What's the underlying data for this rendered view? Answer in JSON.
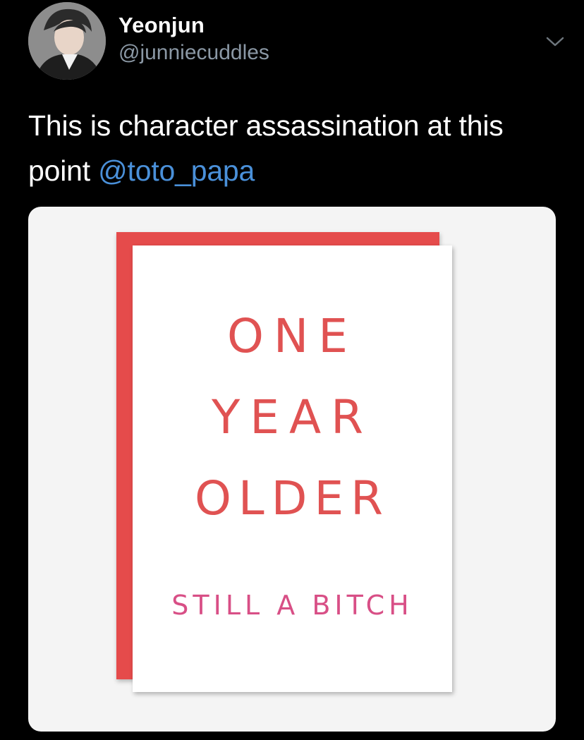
{
  "tweet": {
    "author": {
      "display_name": "Yeonjun",
      "handle": "@junniecuddles",
      "avatar_icon": "profile-photo"
    },
    "menu_icon": "chevron-down-icon",
    "text": "This is character assassination at this point ",
    "mention": "@toto_papa",
    "media": {
      "card_lines": [
        "ONE",
        "YEAR",
        "OLDER",
        "STILL A BITCH"
      ],
      "colors": {
        "envelope": "#e54b4b",
        "card_text": "#e05252",
        "card_subtext": "#d84f86"
      }
    }
  },
  "colors": {
    "background": "#000000",
    "text": "#ffffff",
    "secondary_text": "#8b98a5",
    "link": "#4a90d9"
  }
}
